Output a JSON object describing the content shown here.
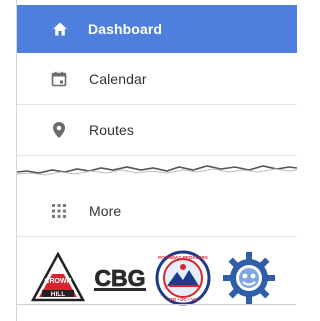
{
  "nav": {
    "items": [
      {
        "label": "Dashboard",
        "icon": "home-icon",
        "active": true
      },
      {
        "label": "Calendar",
        "icon": "calendar-icon",
        "active": false
      },
      {
        "label": "Routes",
        "icon": "map-pin-icon",
        "active": false
      },
      {
        "label": "More",
        "icon": "grid-icon",
        "active": false
      }
    ]
  },
  "logos": {
    "crown_hill": {
      "line1": "CROWN",
      "line2": "HILL"
    },
    "cbg": {
      "text": "CBG"
    },
    "potomac": {
      "text": "POTOMAC PEDALERS",
      "sub": "MD • DC • VA"
    },
    "gear": {
      "icon": "bicycle-gear-icon"
    }
  },
  "colors": {
    "accent": "#4f7fde",
    "icon_gray": "#6b6b6b",
    "text": "#333333",
    "separator": "#e4e4e4"
  }
}
